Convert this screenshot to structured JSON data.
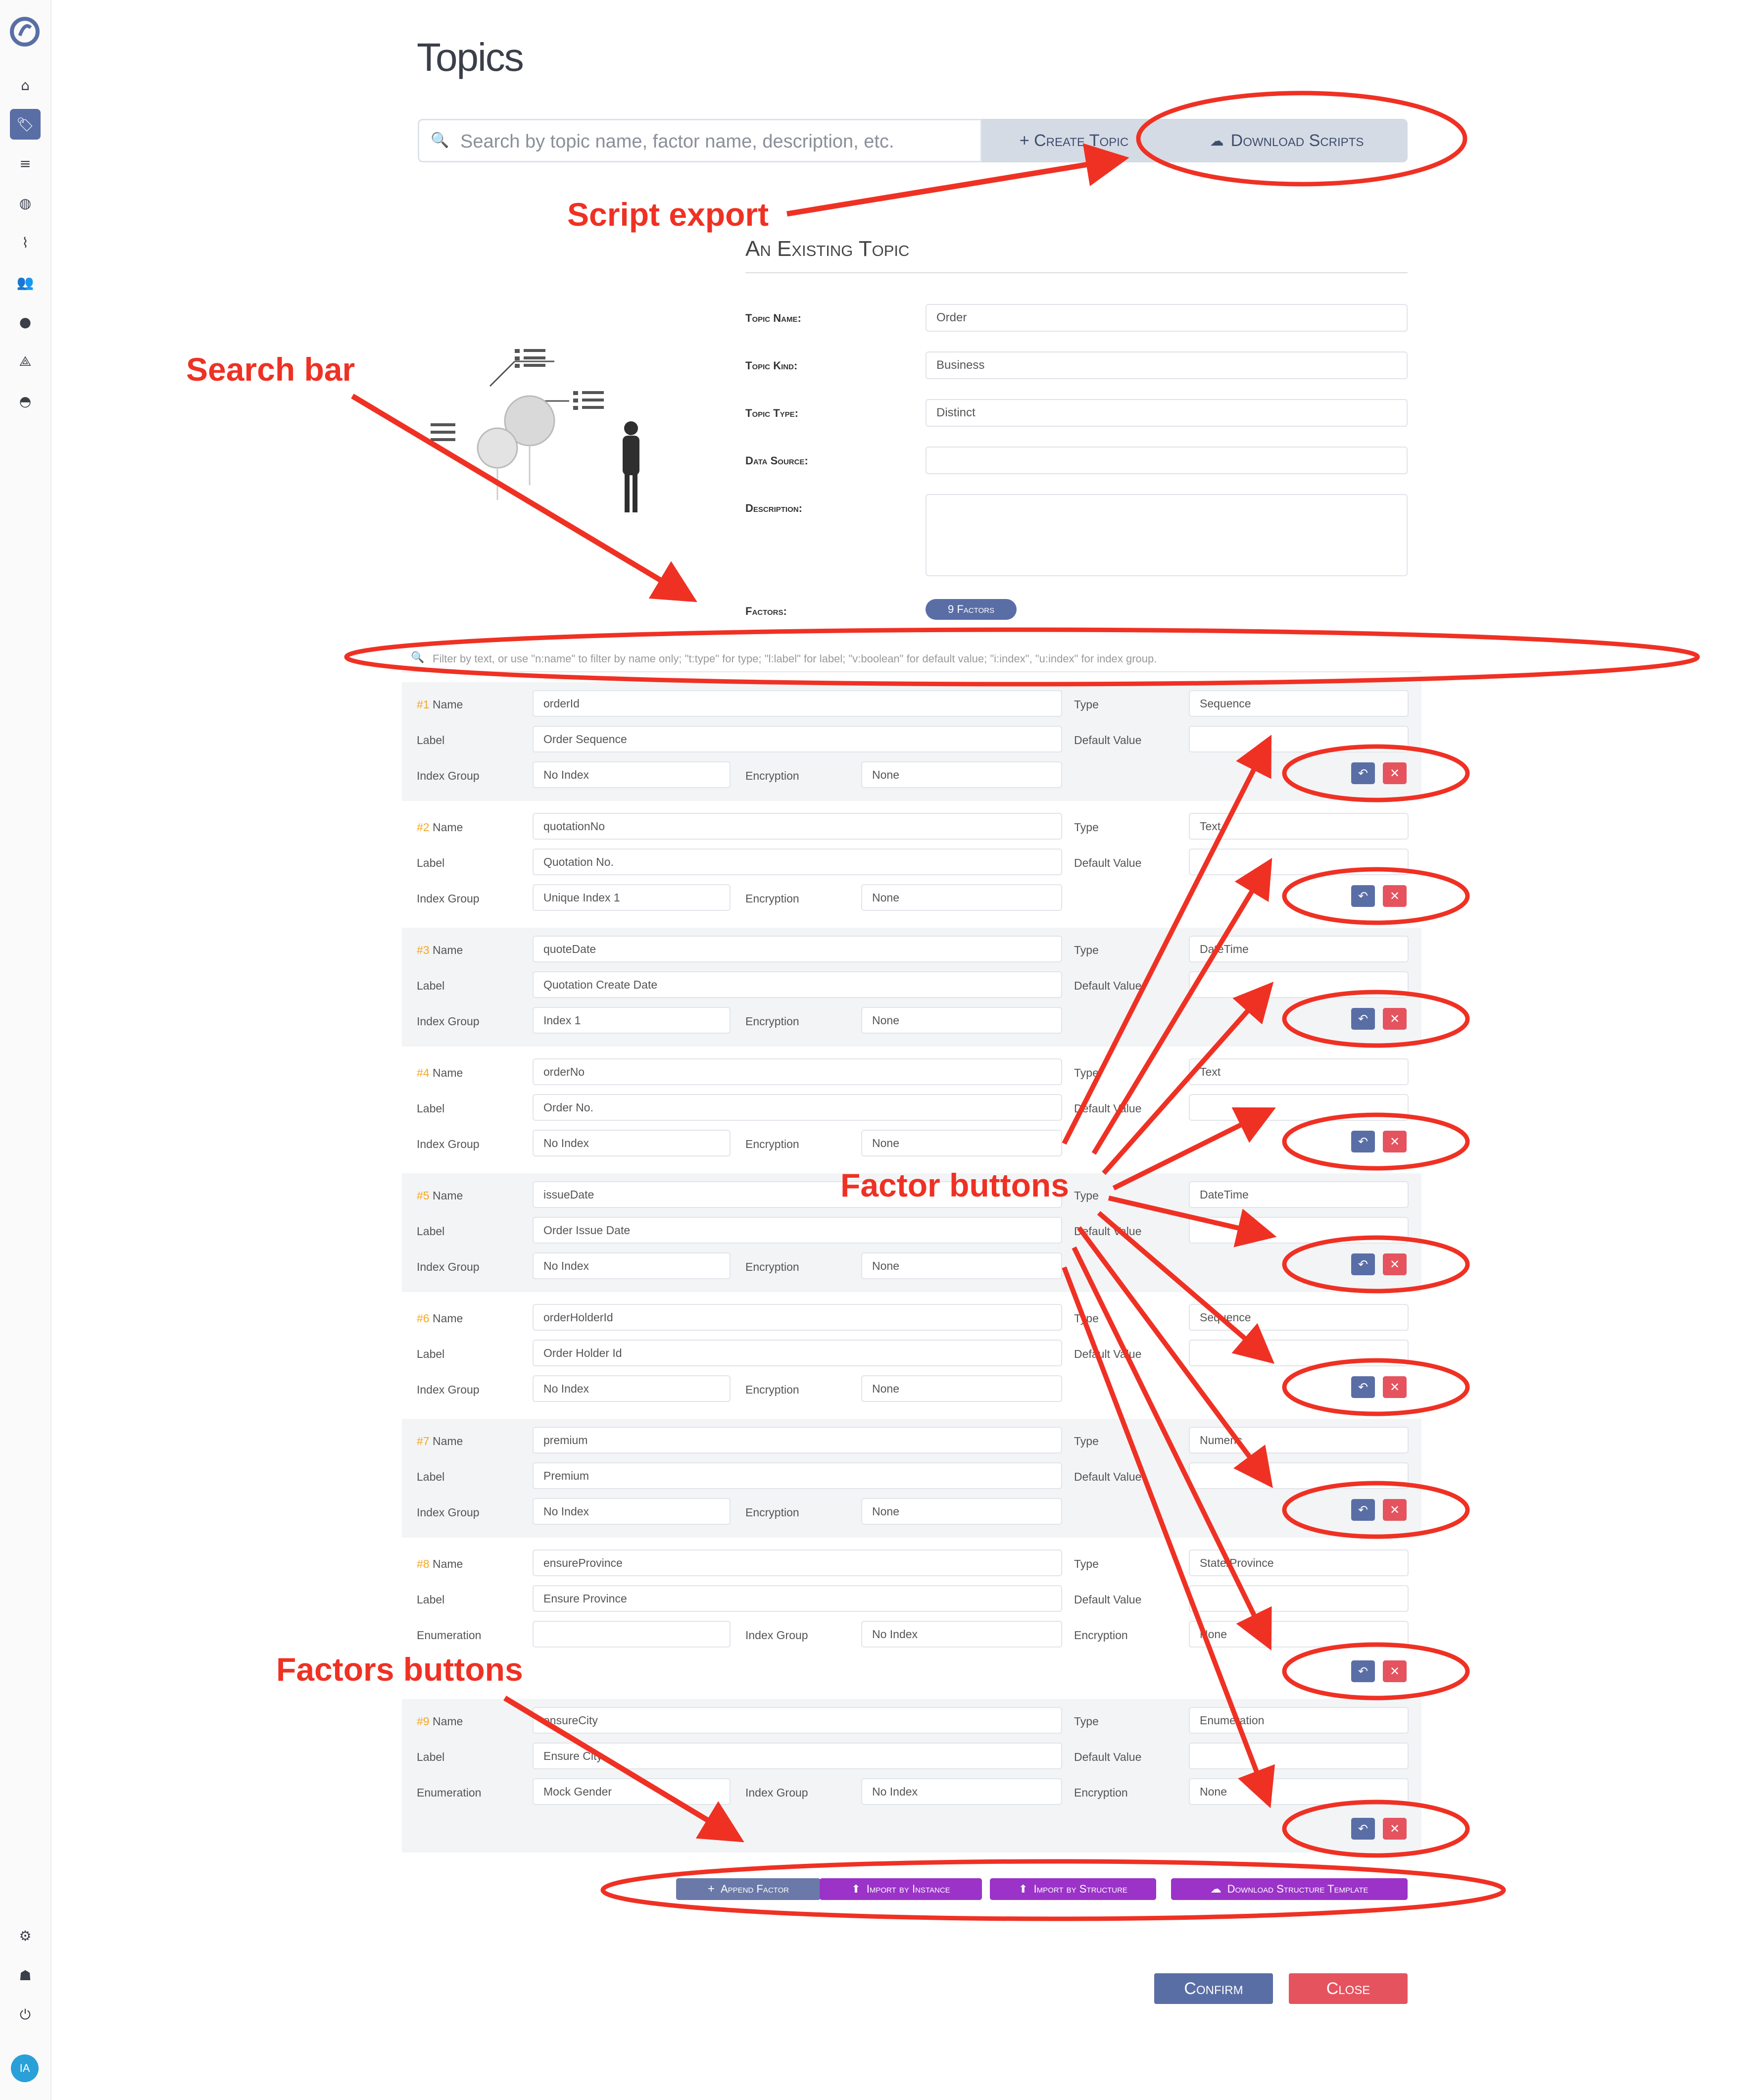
{
  "sidebar": {
    "items": [
      {
        "icon": "logo-icon"
      },
      {
        "icon": "home-icon"
      },
      {
        "icon": "tag-icon"
      },
      {
        "icon": "list-icon"
      },
      {
        "icon": "globe-icon"
      },
      {
        "icon": "pipeline-icon"
      },
      {
        "icon": "users-icon"
      },
      {
        "icon": "user-icon"
      },
      {
        "icon": "compass-icon"
      },
      {
        "icon": "dashboard-icon"
      },
      {
        "icon": "gear-icon"
      },
      {
        "icon": "tenant-icon"
      },
      {
        "icon": "power-icon"
      }
    ],
    "avatar_initials": "IA"
  },
  "page": {
    "title": "Topics"
  },
  "search": {
    "placeholder": "Search by topic name, factor name, description, etc.",
    "create_label": "+ Create Topic",
    "download_label": "Download Scripts"
  },
  "form": {
    "heading": "An Existing Topic",
    "fields": {
      "topic_name_label": "Topic Name:",
      "topic_name": "Order",
      "topic_kind_label": "Topic Kind:",
      "topic_kind": "Business",
      "topic_type_label": "Topic Type:",
      "topic_type": "Distinct",
      "data_source_label": "Data Source:",
      "data_source": "",
      "description_label": "Description:",
      "description": "",
      "factors_label": "Factors:",
      "factors_count": "9 Factors"
    }
  },
  "filter": {
    "placeholder": "Filter by text, or use \"n:name\" to filter by name only; \"t:type\" for type; \"l:label\" for label; \"v:boolean\" for default value; \"i:index\", \"u:index\" for index group."
  },
  "factor_labels": {
    "name": "Name",
    "label": "Label",
    "type": "Type",
    "default_value": "Default Value",
    "index_group": "Index Group",
    "encryption": "Encryption",
    "enumeration": "Enumeration"
  },
  "factors": [
    {
      "num": "#1",
      "name": "orderId",
      "label": "Order Sequence",
      "type": "Sequence",
      "default_value": "",
      "index_group": "No Index",
      "encryption": "None"
    },
    {
      "num": "#2",
      "name": "quotationNo",
      "label": "Quotation No.",
      "type": "Text",
      "default_value": "",
      "index_group": "Unique Index 1",
      "encryption": "None"
    },
    {
      "num": "#3",
      "name": "quoteDate",
      "label": "Quotation Create Date",
      "type": "DateTime",
      "default_value": "",
      "index_group": "Index 1",
      "encryption": "None"
    },
    {
      "num": "#4",
      "name": "orderNo",
      "label": "Order No.",
      "type": "Text",
      "default_value": "",
      "index_group": "No Index",
      "encryption": "None"
    },
    {
      "num": "#5",
      "name": "issueDate",
      "label": "Order Issue Date",
      "type": "DateTime",
      "default_value": "",
      "index_group": "No Index",
      "encryption": "None"
    },
    {
      "num": "#6",
      "name": "orderHolderId",
      "label": "Order Holder Id",
      "type": "Sequence",
      "default_value": "",
      "index_group": "No Index",
      "encryption": "None"
    },
    {
      "num": "#7",
      "name": "premium",
      "label": "Premium",
      "type": "Numeric",
      "default_value": "",
      "index_group": "No Index",
      "encryption": "None"
    },
    {
      "num": "#8",
      "name": "ensureProvince",
      "label": "Ensure Province",
      "type": "State/Province",
      "default_value": "",
      "enumeration": "",
      "index_group": "No Index",
      "encryption": "None"
    },
    {
      "num": "#9",
      "name": "ensureCity",
      "label": "Ensure City",
      "type": "Enumeration",
      "default_value": "",
      "enumeration": "Mock Gender",
      "index_group": "No Index",
      "encryption": "None"
    }
  ],
  "factor_actions": {
    "undo_icon": "undo-icon",
    "delete_icon": "close-icon"
  },
  "bottom_buttons": {
    "append": "Append Factor",
    "import_instance": "Import by Instance",
    "import_structure": "Import by Structure",
    "download_template": "Download Structure Template"
  },
  "dialog": {
    "confirm": "Confirm",
    "close": "Close"
  },
  "annotations": {
    "script_export": "Script export",
    "search_bar": "Search bar",
    "factor_buttons": "Factor buttons",
    "factors_buttons": "Factors buttons"
  },
  "colors": {
    "accent": "#5a6ea6",
    "danger": "#e5535f",
    "purple": "#9b33c8",
    "annotation": "#ef3124",
    "index_number": "#f5a623"
  }
}
